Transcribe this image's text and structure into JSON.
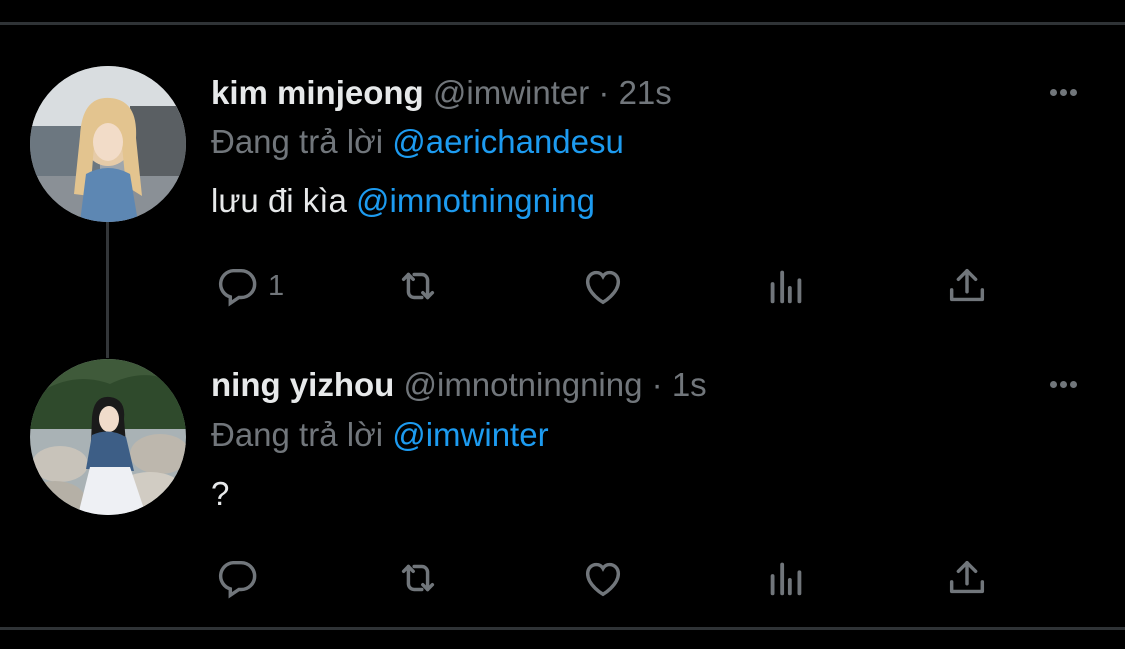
{
  "colors": {
    "background": "#000000",
    "text": "#e7e9ea",
    "muted": "#71767b",
    "link": "#1d9bf0",
    "divider": "#2f3336"
  },
  "icons": {
    "reply": "speech-bubble-icon",
    "retweet": "retweet-arrows-icon",
    "like": "heart-icon",
    "views": "bar-chart-icon",
    "share": "share-upload-icon",
    "more": "three-dots-icon"
  },
  "tweets": [
    {
      "name": "kim minjeong",
      "handle": "@imwinter",
      "separator": "·",
      "time": "21s",
      "replying_prefix": "Đang trả lời",
      "replying_to": "@aerichandesu",
      "text_plain": "lưu đi kìa ",
      "text_mention": "@imnotningning",
      "reply_count": "1"
    },
    {
      "name": "ning yizhou",
      "handle": "@imnotningning",
      "separator": "·",
      "time": "1s",
      "replying_prefix": "Đang trả lời",
      "replying_to": "@imwinter",
      "text_plain": "?",
      "text_mention": "",
      "reply_count": ""
    }
  ]
}
